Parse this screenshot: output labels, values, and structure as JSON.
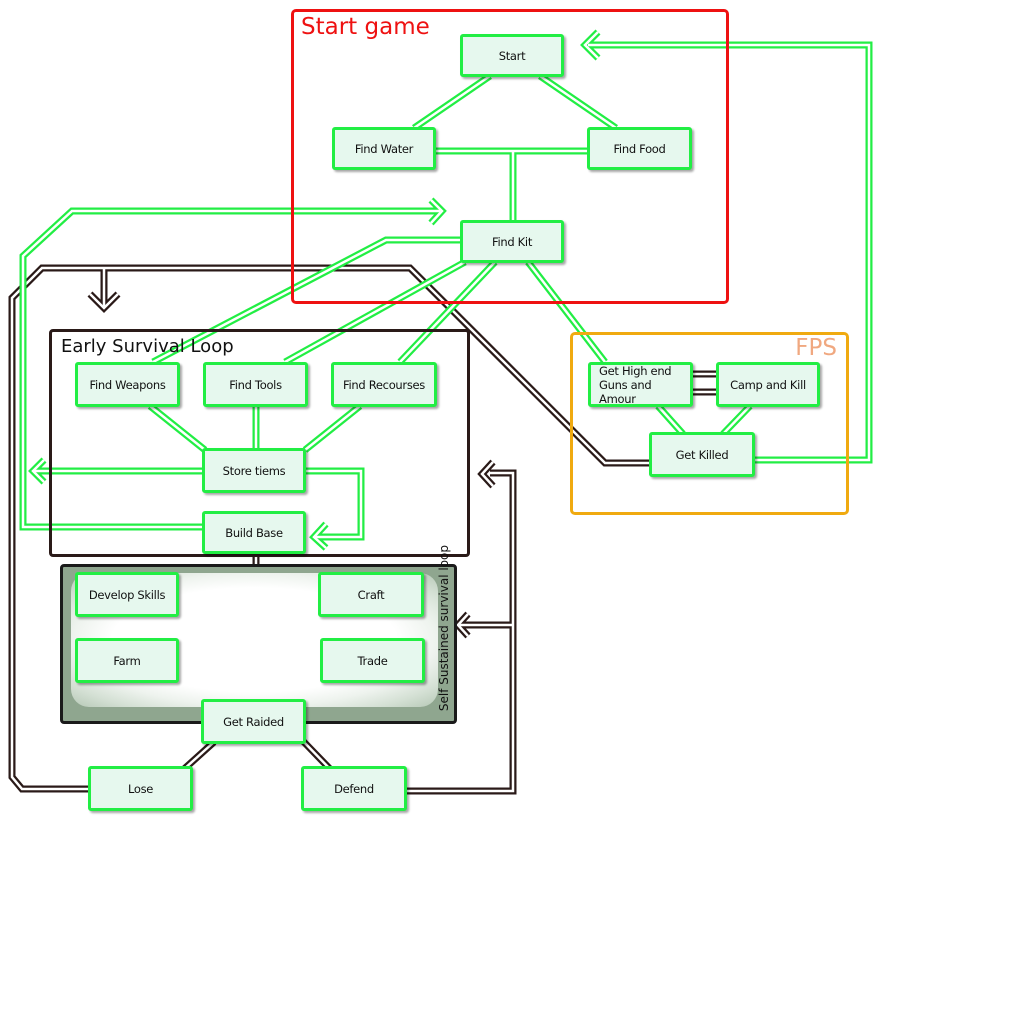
{
  "groups": {
    "start_game": "Start game",
    "fps": "FPS",
    "early_survival": "Early Survival Loop",
    "self_sustained": "Self Sustained survival loop"
  },
  "nodes": {
    "start": "Start",
    "find_water": "Find Water",
    "find_food": "Find Food",
    "find_kit": "Find Kit",
    "get_high_end_1": "Get High end",
    "get_high_end_2": "Guns and Amour",
    "camp_and_kill": "Camp and Kill",
    "get_killed": "Get Killed",
    "find_weapons": "Find Weapons",
    "find_tools": "Find Tools",
    "find_recourses": "Find Recourses",
    "store_items": "Store tiems",
    "build_base": "Build Base",
    "develop_skills": "Develop Skills",
    "craft": "Craft",
    "farm": "Farm",
    "trade": "Trade",
    "get_raided": "Get Raided",
    "lose": "Lose",
    "defend": "Defend"
  },
  "colors": {
    "start_group": "#ee1111",
    "fps_group": "#f0aa10",
    "fps_title": "#f0a880",
    "node_border": "#22ee44",
    "node_fill": "#e6f8ee",
    "green_wire": "#22ee44",
    "dark_wire": "#2a1a18"
  }
}
